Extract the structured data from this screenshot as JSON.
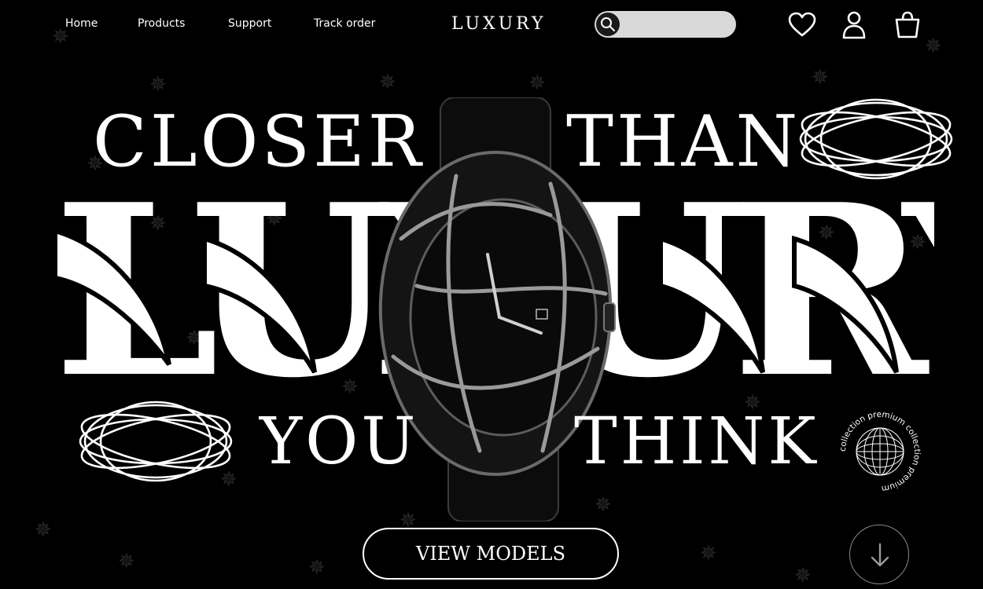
{
  "nav": {
    "links": [
      {
        "label": "Home"
      },
      {
        "label": "Products"
      },
      {
        "label": "Support"
      },
      {
        "label": "Track order"
      }
    ],
    "logo": "LUXURY",
    "search": {
      "value": "",
      "placeholder": "",
      "icon": "search-icon"
    },
    "actions": [
      {
        "icon": "heart-icon"
      },
      {
        "icon": "user-icon"
      },
      {
        "icon": "shopping-bag-icon"
      }
    ]
  },
  "hero": {
    "line1_left": "CLOSER",
    "line1_right": "THAN",
    "brand_word": "LUXURY",
    "line3_left": "YOU",
    "line3_right": "THINK",
    "badge_text": "collection premium collection premium",
    "cta_label": "VIEW MODELS",
    "scroll_icon": "arrow-down-icon"
  },
  "colors": {
    "background": "#000000",
    "foreground": "#ffffff",
    "search_bg": "#d9d9d9",
    "watch": "#141414"
  }
}
